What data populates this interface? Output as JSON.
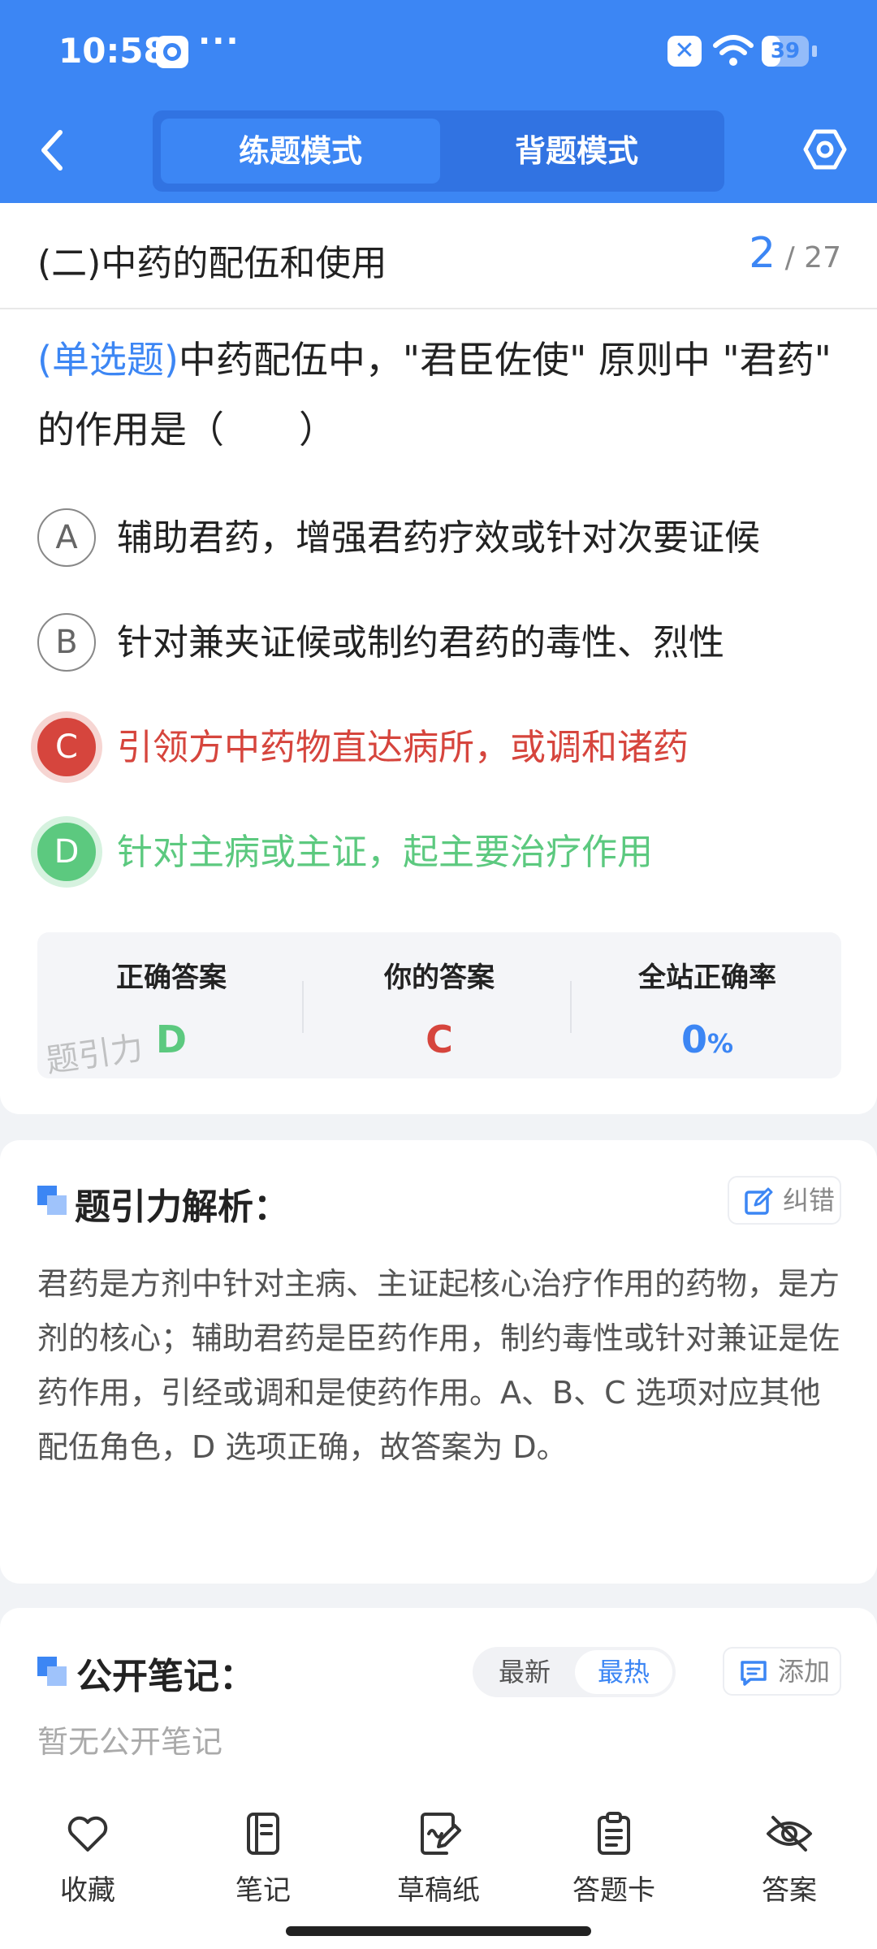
{
  "status_bar": {
    "time": "10:58",
    "dots": "···",
    "sim_label": "✕",
    "battery": "39",
    "battery_level": 0.39
  },
  "header": {
    "tabs": [
      {
        "label": "练题模式",
        "active": true
      },
      {
        "label": "背题模式",
        "active": false
      }
    ]
  },
  "chapter": {
    "title": "(二)中药的配伍和使用",
    "current": "2",
    "total": "/ 27"
  },
  "question": {
    "type_label": "(单选题)",
    "text": "中药配伍中，\"君臣佐使\" 原则中 \"君药\" 的作用是（　　）"
  },
  "options": [
    {
      "letter": "A",
      "text": "辅助君药，增强君药疗效或针对次要证候",
      "state": "normal"
    },
    {
      "letter": "B",
      "text": "针对兼夹证候或制约君药的毒性、烈性",
      "state": "normal"
    },
    {
      "letter": "C",
      "text": "引领方中药物直达病所，或调和诸药",
      "state": "wrong"
    },
    {
      "letter": "D",
      "text": "针对主病或主证，起主要治疗作用",
      "state": "right"
    }
  ],
  "answer_summary": {
    "correct_label": "正确答案",
    "correct_value": "D",
    "yours_label": "你的答案",
    "yours_value": "C",
    "rate_label": "全站正确率",
    "rate_value": "0",
    "rate_unit": "%",
    "watermark": "题引力"
  },
  "analysis": {
    "title": "题引力解析：",
    "report_button": "纠错",
    "text": "君药是方剂中针对主病、主证起核心治疗作用的药物，是方剂的核心；辅助君药是臣药作用，制约毒性或针对兼证是佐药作用，引经或调和是使药作用。A、B、C 选项对应其他配伍角色，D 选项正确，故答案为 D。"
  },
  "notes": {
    "title": "公开笔记：",
    "sort_options": [
      "最新",
      "最热"
    ],
    "add_button": "添加",
    "empty_text": "暂无公开笔记"
  },
  "bottom_nav": [
    {
      "label": "收藏",
      "icon": "heart-icon"
    },
    {
      "label": "笔记",
      "icon": "notebook-icon"
    },
    {
      "label": "草稿纸",
      "icon": "draft-pen-icon"
    },
    {
      "label": "答题卡",
      "icon": "clipboard-icon"
    },
    {
      "label": "答案",
      "icon": "eye-off-icon"
    }
  ],
  "colors": {
    "primary": "#3c86f4",
    "wrong": "#d6453d",
    "right": "#5cc97f"
  }
}
